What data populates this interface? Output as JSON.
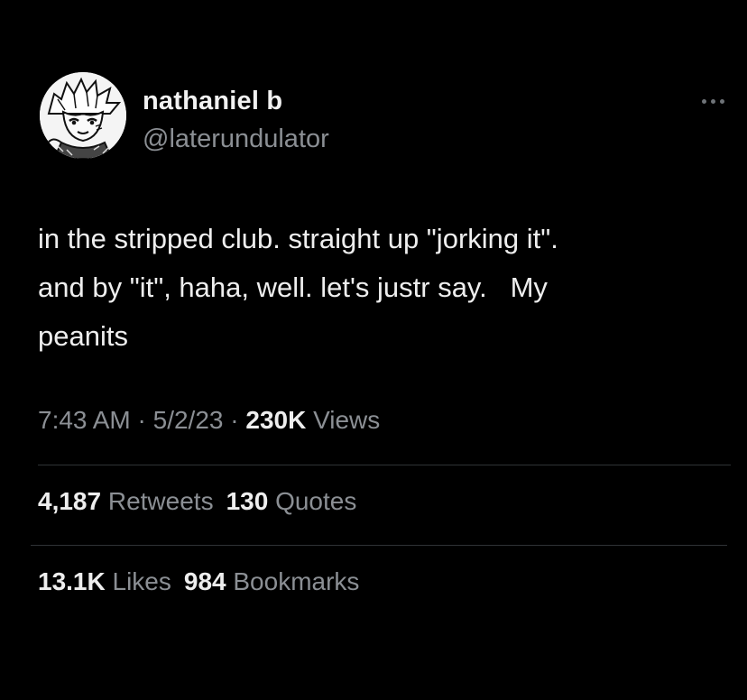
{
  "author": {
    "display_name": "nathaniel b",
    "handle": "@laterundulator",
    "avatar_icon": "anime-avatar"
  },
  "more_menu": {
    "icon": "more-dots-icon"
  },
  "tweet": {
    "text": "in the stripped club. straight up \"jorking it\".\nand by \"it\", haha, well. let's justr say.   My\npeanits"
  },
  "meta": {
    "time": "7:43 AM",
    "sep1": " · ",
    "date": "5/2/23",
    "sep2": " · ",
    "views_count": "230K",
    "views_label": "Views"
  },
  "engagement": {
    "retweets_count": "4,187",
    "retweets_label": "Retweets",
    "quotes_count": "130",
    "quotes_label": "Quotes",
    "likes_count": "13.1K",
    "likes_label": "Likes",
    "bookmarks_count": "984",
    "bookmarks_label": "Bookmarks"
  },
  "colors": {
    "background": "#000000",
    "primary_text": "#eeeeee",
    "secondary_text": "#8b8f94",
    "divider": "#2f3336"
  }
}
